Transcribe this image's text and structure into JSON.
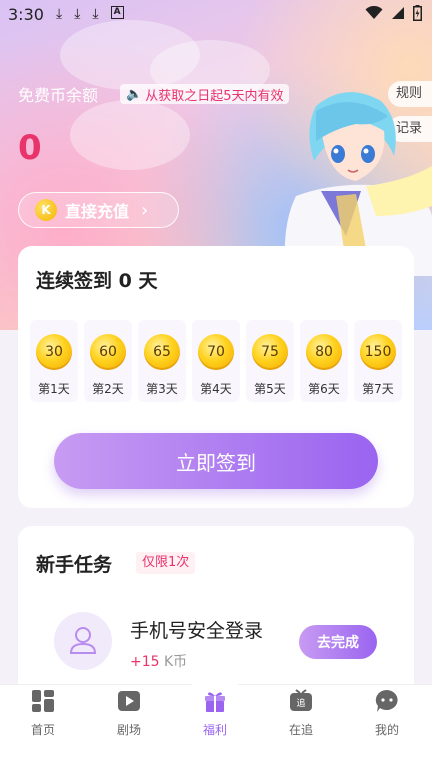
{
  "status_bar": {
    "time": "3:30",
    "icons_left": [
      "download-icon",
      "download-icon",
      "download-icon",
      "text-a-icon"
    ],
    "icons_right": [
      "wifi-icon",
      "signal-icon",
      "battery-charging-icon"
    ]
  },
  "balance": {
    "label": "免费币余额",
    "validity_notice": "从获取之日起5天内有效",
    "value": "0"
  },
  "side_buttons": {
    "rules": "规则",
    "records": "记录"
  },
  "recharge": {
    "coin_letter": "K",
    "label": "直接充值"
  },
  "signin": {
    "title": "连续签到 0 天",
    "days": [
      {
        "reward": "30",
        "label": "第1天"
      },
      {
        "reward": "60",
        "label": "第2天"
      },
      {
        "reward": "65",
        "label": "第3天"
      },
      {
        "reward": "70",
        "label": "第4天"
      },
      {
        "reward": "75",
        "label": "第5天"
      },
      {
        "reward": "80",
        "label": "第6天"
      },
      {
        "reward": "150",
        "label": "第7天"
      }
    ],
    "button": "立即签到"
  },
  "newbie_tasks": {
    "title": "新手任务",
    "badge": "仅限1次",
    "task": {
      "name": "手机号安全登录",
      "reward_plus": "+15",
      "reward_unit": " K币",
      "button": "去完成"
    }
  },
  "bottom_nav": [
    {
      "label": "首页",
      "icon": "home-grid-icon"
    },
    {
      "label": "剧场",
      "icon": "play-icon"
    },
    {
      "label": "福利",
      "icon": "gift-icon",
      "active": true
    },
    {
      "label": "在追",
      "icon": "tv-follow-icon"
    },
    {
      "label": "我的",
      "icon": "profile-chat-icon"
    }
  ],
  "colors": {
    "accent": "#9a64f0",
    "highlight": "#e8336b",
    "coin": "#ffd21e"
  }
}
